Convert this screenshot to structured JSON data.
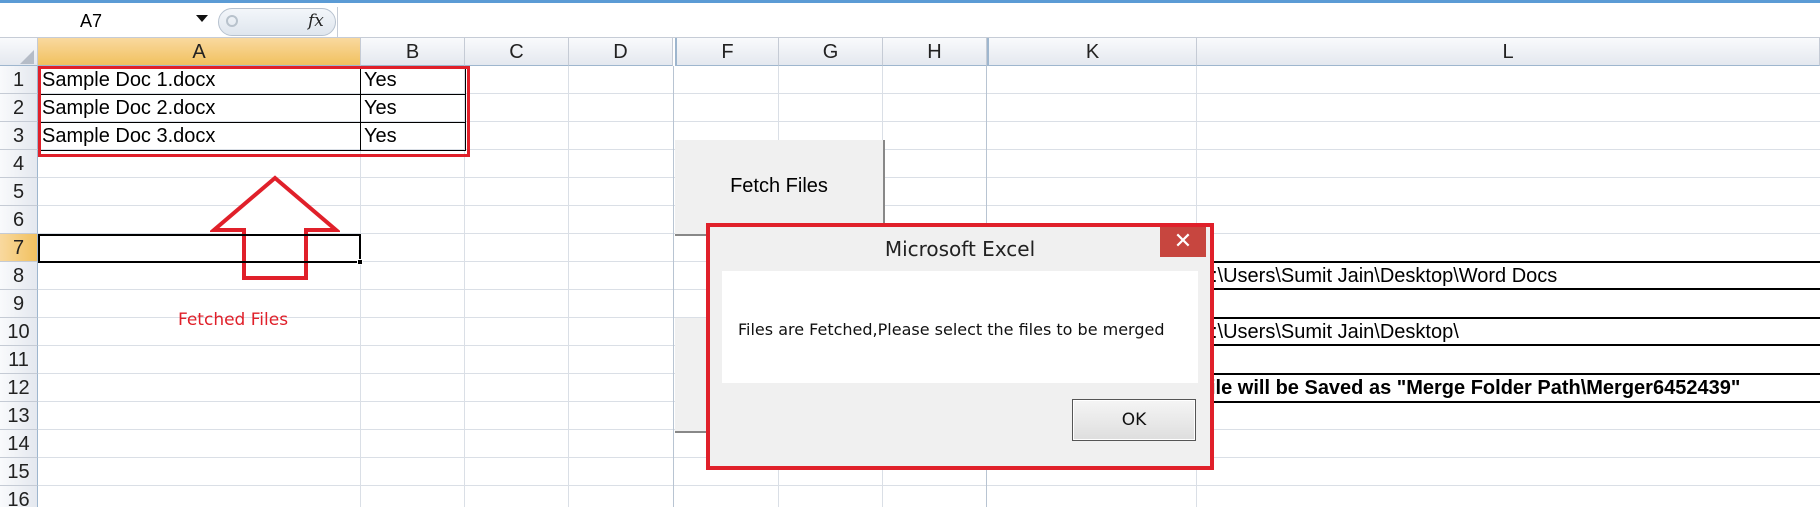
{
  "formula_bar": {
    "name_box": "A7",
    "fx_label": "fx",
    "formula": ""
  },
  "columns": [
    "A",
    "B",
    "C",
    "D",
    "F",
    "G",
    "H",
    "K",
    "L"
  ],
  "rows": [
    "1",
    "2",
    "3",
    "4",
    "5",
    "6",
    "7",
    "8",
    "9",
    "10",
    "11",
    "12",
    "13",
    "14",
    "15",
    "16"
  ],
  "selected_column": "A",
  "selected_row": "7",
  "cells": {
    "A1": "Sample Doc 1.docx",
    "B1": "Yes",
    "A2": "Sample Doc 2.docx",
    "B2": "Yes",
    "A3": "Sample Doc 3.docx",
    "B3": "Yes",
    "K8": ":\\Users\\Sumit Jain\\Desktop\\Word Docs",
    "K10": ":\\Users\\Sumit Jain\\Desktop\\",
    "K12": "ile will be Saved as \"Merge Folder Path\\Merger6452439\""
  },
  "annotation": {
    "label": "Fetched Files",
    "color": "#e0202a"
  },
  "fetch_button": {
    "label": "Fetch Files"
  },
  "dialog": {
    "title": "Microsoft Excel",
    "message": "Files are Fetched,Please select the files to be merged",
    "ok_label": "OK",
    "close_glyph": "✕"
  }
}
